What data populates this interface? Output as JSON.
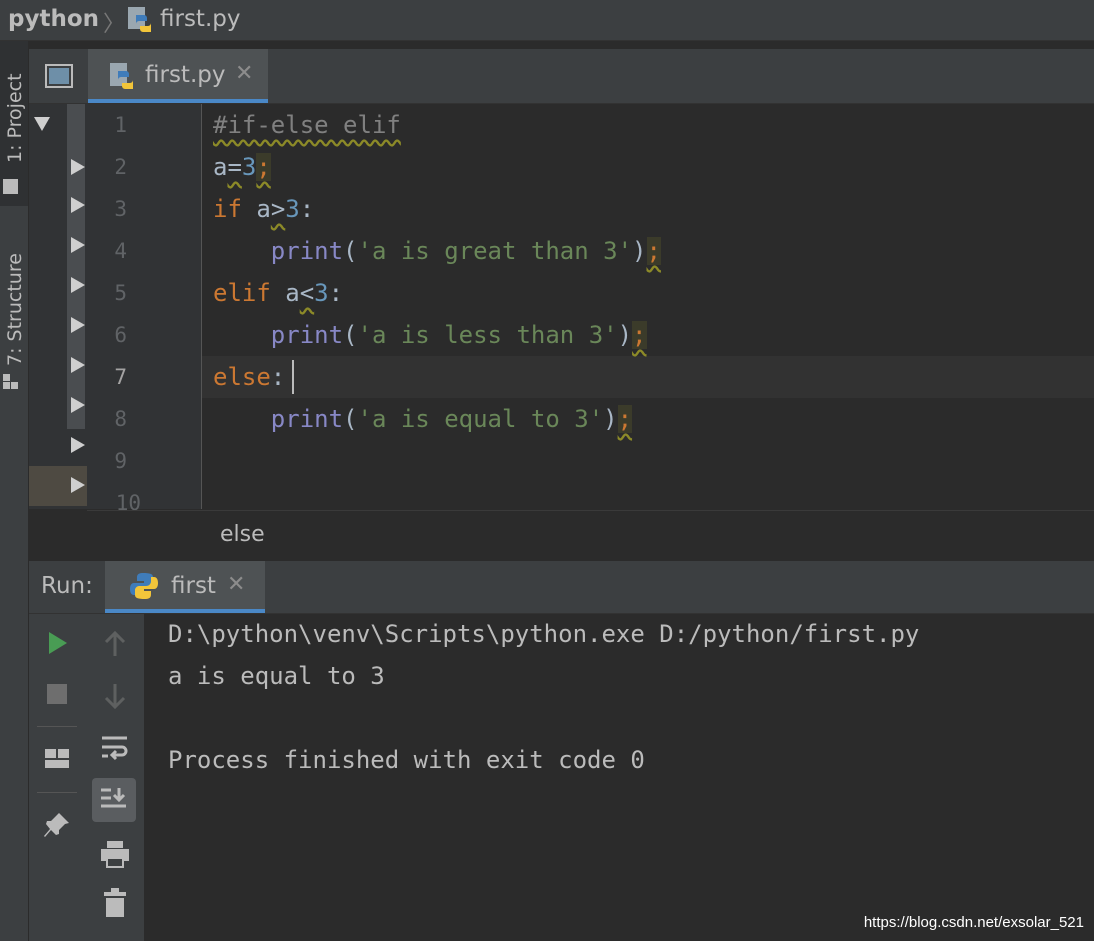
{
  "breadcrumb": {
    "project": "python",
    "file": "first.py"
  },
  "left_stripe": {
    "project_tab": "1: Project",
    "structure_tab": "7: Structure"
  },
  "editor": {
    "tab_label": "first.py",
    "line_numbers": [
      "1",
      "2",
      "3",
      "4",
      "5",
      "6",
      "7",
      "8",
      "9",
      "10"
    ],
    "lines": {
      "l1": "#if-else elif",
      "l2_a": "a",
      "l2_eq": "=",
      "l2_num": "3",
      "l2_semi": ";",
      "l3_if": "if",
      "l3_a": "a",
      "l3_op": ">",
      "l3_num": "3",
      "l3_colon": ":",
      "l4_print": "print",
      "l4_open": "(",
      "l4_str": "'a is great than 3'",
      "l4_close": ")",
      "l4_semi": ";",
      "l5_elif": "elif",
      "l5_a": "a",
      "l5_op": "<",
      "l5_num": "3",
      "l5_colon": ":",
      "l6_print": "print",
      "l6_open": "(",
      "l6_str": "'a is less than 3'",
      "l6_close": ")",
      "l6_semi": ";",
      "l7_else": "else",
      "l7_colon": ":",
      "l8_print": "print",
      "l8_open": "(",
      "l8_str": "'a is equal to 3'",
      "l8_close": ")",
      "l8_semi": ";"
    },
    "code_breadcrumb": "else"
  },
  "run": {
    "label": "Run:",
    "tab_label": "first",
    "console": {
      "command": "D:\\python\\venv\\Scripts\\python.exe D:/python/first.py",
      "output": "a is equal to 3",
      "exit": "Process finished with exit code 0"
    }
  },
  "watermark": "https://blog.csdn.net/exsolar_521",
  "colors": {
    "keyword": "#cc7832",
    "number": "#6897bb",
    "string": "#6a8759",
    "builtin": "#8888c6",
    "accent": "#4a88c7",
    "run_green": "#499c54"
  }
}
